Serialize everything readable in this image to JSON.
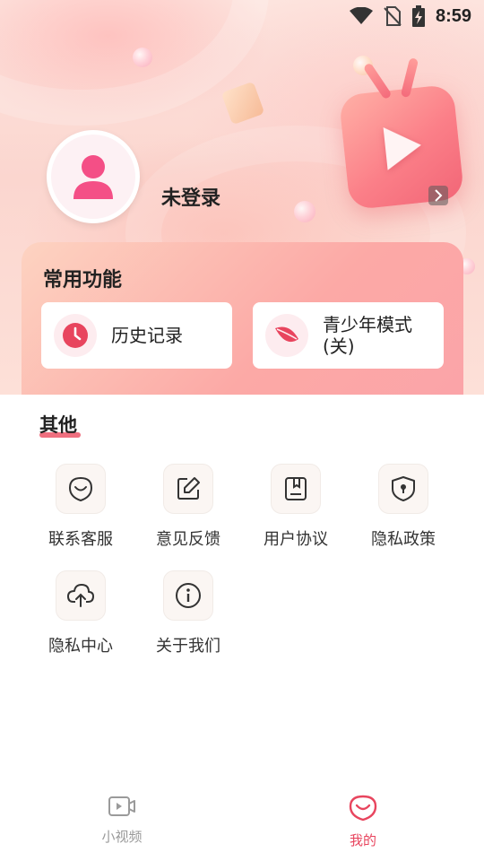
{
  "status_bar": {
    "time": "8:59",
    "icons": [
      "wifi-icon",
      "no-sim-icon",
      "battery-charging-icon"
    ]
  },
  "profile": {
    "login_text": "未登录"
  },
  "common_functions": {
    "title": "常用功能",
    "items": [
      {
        "label": "历史记录",
        "icon": "clock-icon"
      },
      {
        "label": "青少年模式\n(关)",
        "icon": "leaf-icon"
      }
    ]
  },
  "other": {
    "title": "其他",
    "items": [
      {
        "label": "联系客服",
        "icon": "customer-service-icon"
      },
      {
        "label": "意见反馈",
        "icon": "feedback-edit-icon"
      },
      {
        "label": "用户协议",
        "icon": "agreement-book-icon"
      },
      {
        "label": "隐私政策",
        "icon": "privacy-shield-icon"
      },
      {
        "label": "隐私中心",
        "icon": "cloud-upload-icon"
      },
      {
        "label": "关于我们",
        "icon": "info-icon"
      }
    ]
  },
  "bottom_nav": {
    "items": [
      {
        "label": "小视频",
        "icon": "video-icon",
        "active": false
      },
      {
        "label": "我的",
        "icon": "mine-smile-icon",
        "active": true
      }
    ]
  },
  "colors": {
    "accent": "#e8455e",
    "inactive": "#9a9a9a"
  }
}
